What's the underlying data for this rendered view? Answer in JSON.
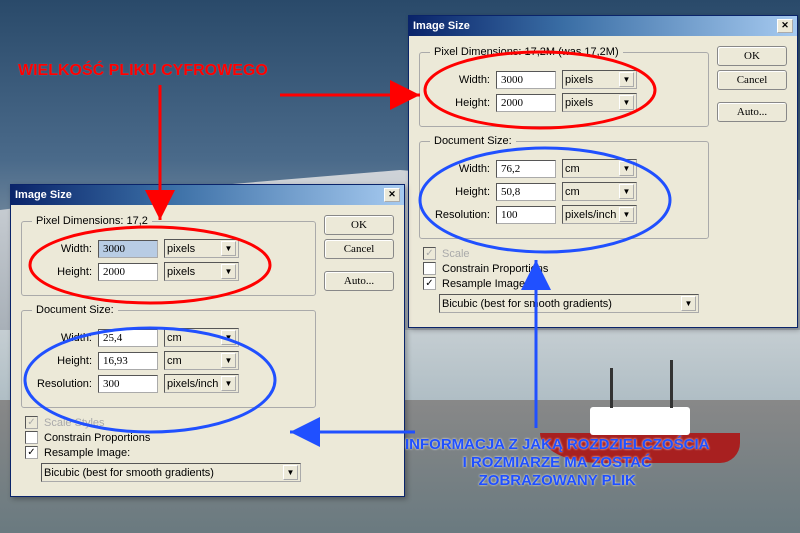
{
  "annotations": {
    "top_red": "WIELKOŚĆ PLIKU CYFROWEGO",
    "bottom_blue_1": "INFORMACJA Z JAKĄ ROZDZIELCZOŚCIA",
    "bottom_blue_2": "I ROZMIARZE  MA ZOSTAĆ",
    "bottom_blue_3": "ZOBRAZOWANY PLIK"
  },
  "dialog1": {
    "title": "Image Size",
    "pixel_dim_label": "Pixel Dimensions: 17,2",
    "width_label": "Width:",
    "height_label": "Height:",
    "resolution_label": "Resolution:",
    "width_val": "3000",
    "height_val": "2000",
    "unit_px": "pixels",
    "doc_label": "Document Size:",
    "doc_width": "25,4",
    "doc_height": "16,93",
    "doc_unit": "cm",
    "resolution": "300",
    "res_unit": "pixels/inch",
    "scale_styles": "Scale Styles",
    "constrain": "Constrain Proportions",
    "resample": "Resample Image:",
    "resample_method": "Bicubic (best for smooth gradients)",
    "ok": "OK",
    "cancel": "Cancel",
    "auto": "Auto..."
  },
  "dialog2": {
    "title": "Image Size",
    "pixel_dim_label": "Pixel Dimensions: 17,2M (was 17,2M)",
    "width_label": "Width:",
    "height_label": "Height:",
    "resolution_label": "Resolution:",
    "width_val": "3000",
    "height_val": "2000",
    "unit_px": "pixels",
    "doc_label": "Document Size:",
    "doc_width": "76,2",
    "doc_height": "50,8",
    "doc_unit": "cm",
    "resolution": "100",
    "res_unit": "pixels/inch",
    "scale_styles_partial": "Scale",
    "constrain": "Constrain Proportions",
    "resample": "Resample Image:",
    "resample_method": "Bicubic (best for smooth gradients)",
    "ok": "OK",
    "cancel": "Cancel",
    "auto": "Auto..."
  }
}
